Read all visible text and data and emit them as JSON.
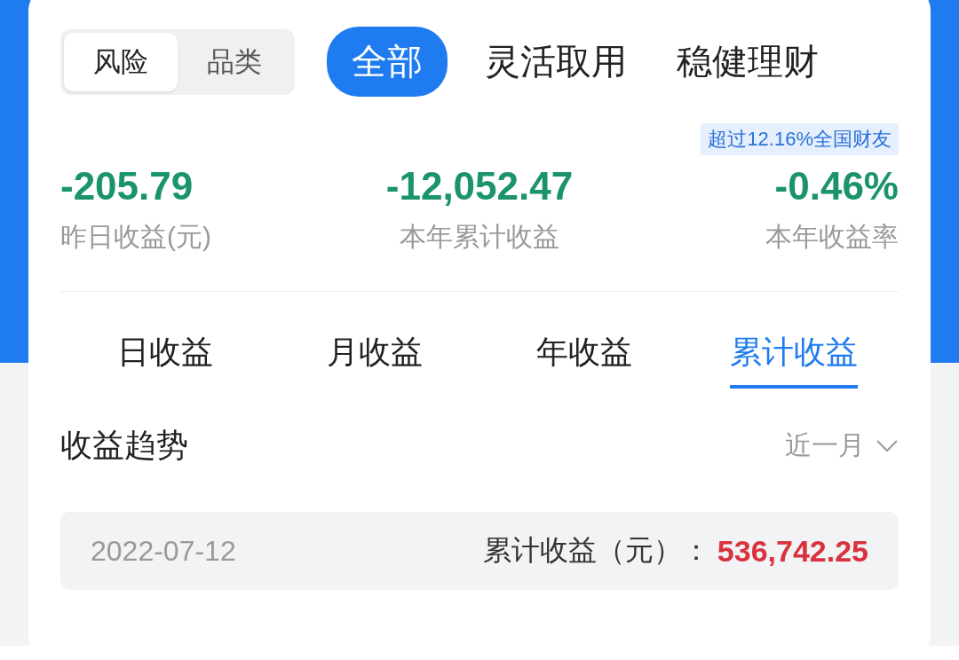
{
  "segmented": [
    {
      "label": "风险",
      "selected": true
    },
    {
      "label": "品类",
      "selected": false
    }
  ],
  "tabs": [
    {
      "label": "全部",
      "selected": true
    },
    {
      "label": "灵活取用",
      "selected": false
    },
    {
      "label": "稳健理财",
      "selected": false
    }
  ],
  "rank_badge": "超过12.16%全国财友",
  "stats": [
    {
      "value": "-205.79",
      "label": "昨日收益(元)"
    },
    {
      "value": "-12,052.47",
      "label": "本年累计收益"
    },
    {
      "value": "-0.46%",
      "label": "本年收益率"
    }
  ],
  "period_tabs": [
    {
      "label": "日收益",
      "selected": false
    },
    {
      "label": "月收益",
      "selected": false
    },
    {
      "label": "年收益",
      "selected": false
    },
    {
      "label": "累计收益",
      "selected": true
    }
  ],
  "trend": {
    "title": "收益趋势",
    "range": "近一月"
  },
  "tooltip": {
    "date": "2022-07-12",
    "label": "累计收益（元）：",
    "value": "536,742.25"
  }
}
